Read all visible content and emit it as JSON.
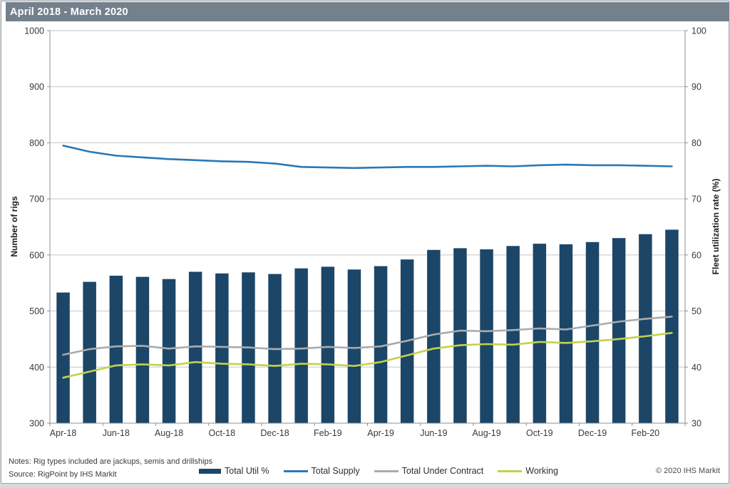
{
  "title": "April 2018 - March 2020",
  "footer": {
    "notes": "Notes: Rig types included are jackups, semis and drillships",
    "source": "Source: RigPoint by IHS Markit",
    "copyright": "© 2020 IHS Markit"
  },
  "colors": {
    "title_bar": "#75808d",
    "bar": "#1c4668",
    "supply": "#2878b8",
    "contract": "#a9acae",
    "working": "#c3d24a",
    "grid": "#c5c5c5",
    "axis": "#8f8f8f"
  },
  "legend": [
    {
      "label": "Total Util %",
      "swatch": "bar",
      "color_key": "bar"
    },
    {
      "label": "Total Supply",
      "swatch": "line",
      "color_key": "supply"
    },
    {
      "label": "Total Under Contract",
      "swatch": "line",
      "color_key": "contract"
    },
    {
      "label": "Working",
      "swatch": "line",
      "color_key": "working"
    }
  ],
  "chart_data": {
    "type": "bar",
    "title": "April 2018 - March 2020",
    "categories": [
      "Apr-18",
      "May-18",
      "Jun-18",
      "Jul-18",
      "Aug-18",
      "Sep-18",
      "Oct-18",
      "Nov-18",
      "Dec-18",
      "Jan-19",
      "Feb-19",
      "Mar-19",
      "Apr-19",
      "May-19",
      "Jun-19",
      "Jul-19",
      "Aug-19",
      "Sep-19",
      "Oct-19",
      "Nov-19",
      "Dec-19",
      "Jan-20",
      "Feb-20",
      "Mar-20"
    ],
    "x_label_interval": 2,
    "left_axis": {
      "label": "Number of rigs",
      "min": 300,
      "max": 1000,
      "step": 100
    },
    "right_axis": {
      "label": "Fleet utilization rate (%)",
      "min": 30,
      "max": 100,
      "step": 10
    },
    "grid": true,
    "legend_position": "bottom",
    "series": [
      {
        "name": "Total Util %",
        "type": "bar",
        "axis": "right",
        "values": [
          53.3,
          55.2,
          56.3,
          56.1,
          55.7,
          57.0,
          56.7,
          56.9,
          56.6,
          57.6,
          57.9,
          57.4,
          58.0,
          59.2,
          60.9,
          61.2,
          61.0,
          61.6,
          62.0,
          61.9,
          62.3,
          63.0,
          63.7,
          64.5
        ]
      },
      {
        "name": "Total Supply",
        "type": "line",
        "axis": "left",
        "values": [
          795,
          784,
          777,
          774,
          771,
          769,
          767,
          766,
          763,
          757,
          756,
          755,
          756,
          757,
          757,
          758,
          759,
          758,
          760,
          761,
          760,
          760,
          759,
          758
        ]
      },
      {
        "name": "Total Under Contract",
        "type": "line",
        "axis": "left",
        "values": [
          422,
          432,
          437,
          438,
          433,
          437,
          436,
          435,
          432,
          433,
          436,
          434,
          437,
          447,
          458,
          465,
          464,
          466,
          469,
          467,
          474,
          481,
          486,
          490
        ]
      },
      {
        "name": "Working",
        "type": "line",
        "axis": "left",
        "values": [
          381,
          392,
          403,
          405,
          403,
          409,
          406,
          405,
          402,
          406,
          405,
          402,
          409,
          421,
          433,
          439,
          441,
          440,
          445,
          443,
          446,
          450,
          455,
          461
        ]
      }
    ]
  }
}
